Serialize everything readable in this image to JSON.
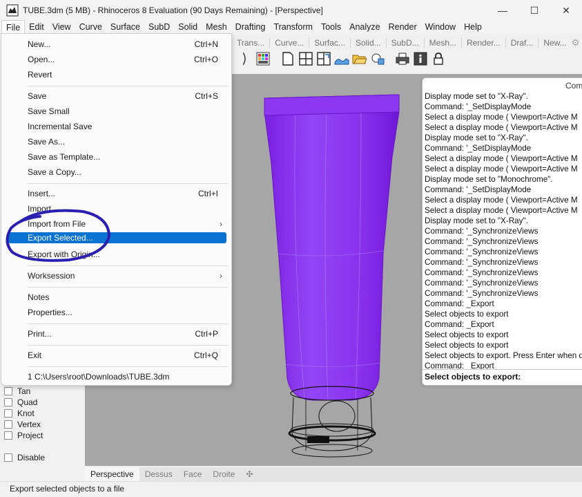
{
  "window": {
    "title": "TUBE.3dm (5 MB) - Rhinoceros 8 Evaluation (90 Days Remaining) - [Perspective]",
    "controls": {
      "minimize": "—",
      "maximize": "☐",
      "close": "✕"
    }
  },
  "menubar": {
    "items": [
      "File",
      "Edit",
      "View",
      "Curve",
      "Surface",
      "SubD",
      "Solid",
      "Mesh",
      "Drafting",
      "Transform",
      "Tools",
      "Analyze",
      "Render",
      "Window",
      "Help"
    ],
    "active": "File"
  },
  "toolbar_tabs": [
    "Trans...",
    "Curve...",
    "Surfac...",
    "Solid...",
    "SubD...",
    "Mesh...",
    "Render...",
    "Draf...",
    "New..."
  ],
  "toolbar_icons": [
    "shaded-sphere-icon",
    "color-palette-icon",
    "new-file-icon",
    "four-viewports-icon",
    "viewport-layout-icon",
    "drape-surface-icon",
    "open-folder-icon",
    "render-settings-icon",
    "print-icon",
    "info-icon",
    "lock-icon"
  ],
  "file_menu": {
    "items": [
      {
        "label": "New...",
        "shortcut": "Ctrl+N"
      },
      {
        "label": "Open...",
        "shortcut": "Ctrl+O"
      },
      {
        "label": "Revert",
        "shortcut": ""
      },
      {
        "label": "Save",
        "shortcut": "Ctrl+S"
      },
      {
        "label": "Save Small",
        "shortcut": ""
      },
      {
        "label": "Incremental Save",
        "shortcut": ""
      },
      {
        "label": "Save As...",
        "shortcut": ""
      },
      {
        "label": "Save as Template...",
        "shortcut": ""
      },
      {
        "label": "Save a Copy...",
        "shortcut": ""
      },
      {
        "label": "Insert...",
        "shortcut": "Ctrl+I"
      },
      {
        "label": "Import...",
        "shortcut": ""
      },
      {
        "label": "Import from File",
        "shortcut": "",
        "submenu": true
      },
      {
        "label": "Export Selected...",
        "shortcut": "",
        "highlighted": true
      },
      {
        "label": "Export with Origin...",
        "shortcut": ""
      },
      {
        "label": "Worksession",
        "shortcut": "",
        "submenu": true
      },
      {
        "label": "Notes",
        "shortcut": ""
      },
      {
        "label": "Properties...",
        "shortcut": ""
      },
      {
        "label": "Print...",
        "shortcut": "Ctrl+P"
      },
      {
        "label": "Exit",
        "shortcut": "Ctrl+Q"
      },
      {
        "label": "1 C:\\Users\\root\\Downloads\\TUBE.3dm",
        "shortcut": ""
      }
    ],
    "submenu_arrow": "›"
  },
  "osnap": {
    "items": [
      "Tan",
      "Quad",
      "Knot",
      "Vertex",
      "Project"
    ],
    "disable_label": "Disable"
  },
  "command_window": {
    "title": "Com",
    "history": [
      "Display mode set to \"X-Ray\".",
      "Command: '_SetDisplayMode",
      "Select a display mode ( Viewport=Active  M",
      "Select a display mode ( Viewport=Active  M",
      "Display mode set to \"X-Ray\".",
      "Command: '_SetDisplayMode",
      "Select a display mode ( Viewport=Active  M",
      "Select a display mode ( Viewport=Active  M",
      "Display mode set to \"Monochrome\".",
      "Command: '_SetDisplayMode",
      "Select a display mode ( Viewport=Active  M",
      "Select a display mode ( Viewport=Active  M",
      "Display mode set to \"X-Ray\".",
      "Command: '_SynchronizeViews",
      "Command: '_SynchronizeViews",
      "Command: '_SynchronizeViews",
      "Command: '_SynchronizeViews",
      "Command: '_SynchronizeViews",
      "Command: '_SynchronizeViews",
      "Command: '_SynchronizeViews",
      "Command: _Export",
      "Select objects to export",
      "Command: _Export",
      "Select objects to export",
      "Select objects to export",
      "Select objects to export. Press Enter when d",
      "Command: _Export"
    ],
    "prompt": "Select objects to export:"
  },
  "viewport": {
    "tabs": [
      "Perspective",
      "Dessus",
      "Face",
      "Droite"
    ],
    "active_tab": "Perspective",
    "add_tab": "✣",
    "tube_color": "#8a2be2",
    "background": "#a6a6a6"
  },
  "status": {
    "text": "Export selected objects to a file"
  },
  "colors": {
    "highlight": "#0a73d0",
    "annotation": "#2a1fb0"
  }
}
